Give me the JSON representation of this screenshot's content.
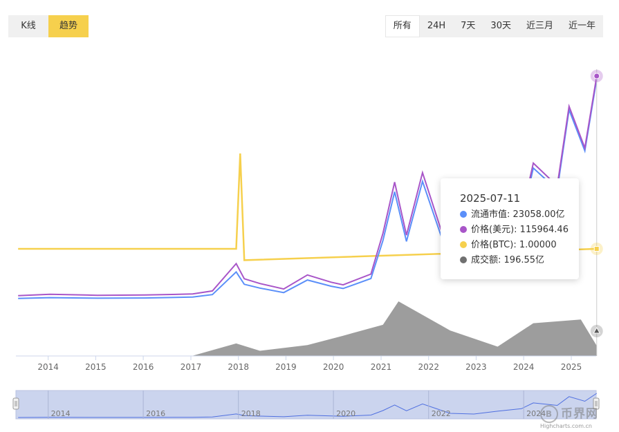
{
  "toolbar": {
    "modes": [
      {
        "label": "K线",
        "active": false
      },
      {
        "label": "趋势",
        "active": true
      }
    ],
    "ranges": [
      {
        "label": "所有",
        "active": true
      },
      {
        "label": "24H",
        "active": false
      },
      {
        "label": "7天",
        "active": false
      },
      {
        "label": "30天",
        "active": false
      },
      {
        "label": "近三月",
        "active": false
      },
      {
        "label": "近一年",
        "active": false
      }
    ]
  },
  "tooltip": {
    "date": "2025-07-11",
    "rows": [
      {
        "name": "流通市值",
        "value": "23058.00亿",
        "color": "#5b8ff9"
      },
      {
        "name": "价格(美元)",
        "value": "115964.46",
        "color": "#a855c8"
      },
      {
        "name": "价格(BTC)",
        "value": "1.00000",
        "color": "#f6d04d"
      },
      {
        "name": "成交额",
        "value": "196.55亿",
        "color": "#707070"
      }
    ]
  },
  "navigator": {
    "labels": [
      "2014",
      "2016",
      "2018",
      "2020",
      "2022",
      "2024"
    ]
  },
  "watermark": {
    "logo": "币界网",
    "credit": "Highcharts.com.cn"
  },
  "chart_data": {
    "type": "line",
    "x_range": [
      "2013-04-28",
      "2025-07-11"
    ],
    "x_ticks": [
      "2014",
      "2015",
      "2016",
      "2017",
      "2018",
      "2019",
      "2020",
      "2021",
      "2022",
      "2023",
      "2024",
      "2025"
    ],
    "colors": {
      "market_cap": "#5b8ff9",
      "price_usd": "#a855c8",
      "price_btc": "#f6d04d",
      "volume": "#8c8c8c"
    },
    "series": [
      {
        "name": "价格(美元)",
        "x": [
          "2013-05",
          "2014-01",
          "2015-01",
          "2016-01",
          "2017-01",
          "2017-06",
          "2017-12",
          "2018-02",
          "2018-06",
          "2018-12",
          "2019-06",
          "2019-12",
          "2020-03",
          "2020-10",
          "2021-01",
          "2021-04",
          "2021-07",
          "2021-11",
          "2022-06",
          "2022-12",
          "2023-06",
          "2023-12",
          "2024-03",
          "2024-09",
          "2024-12",
          "2025-04",
          "2025-07"
        ],
        "y": [
          120,
          800,
          300,
          430,
          1000,
          2600,
          17000,
          9000,
          6500,
          3600,
          11000,
          7200,
          5800,
          11500,
          33000,
          60000,
          32000,
          65000,
          20000,
          16500,
          30000,
          42000,
          70000,
          58000,
          100000,
          78000,
          115964
        ]
      },
      {
        "name": "流通市值",
        "x": [
          "2013-05",
          "2014-01",
          "2015-01",
          "2016-01",
          "2017-01",
          "2017-06",
          "2017-12",
          "2018-02",
          "2018-06",
          "2018-12",
          "2019-06",
          "2019-12",
          "2020-03",
          "2020-10",
          "2021-01",
          "2021-04",
          "2021-07",
          "2021-11",
          "2022-06",
          "2022-12",
          "2023-06",
          "2023-12",
          "2024-03",
          "2024-09",
          "2024-12",
          "2025-04",
          "2025-07"
        ],
        "y": [
          13,
          98,
          42,
          64,
          160,
          420,
          2800,
          1500,
          1100,
          630,
          1950,
          1300,
          1060,
          2100,
          6100,
          11200,
          6000,
          12300,
          3800,
          3170,
          5800,
          8200,
          13700,
          11400,
          19800,
          15500,
          23058
        ]
      },
      {
        "name": "价格(BTC)",
        "x": [
          "2013-05",
          "2017-12",
          "2018-01",
          "2018-02",
          "2025-07"
        ],
        "y": [
          1,
          1,
          5.2,
          0.5,
          1
        ]
      },
      {
        "name": "成交额",
        "x": [
          "2013-05",
          "2017-01",
          "2017-12",
          "2018-06",
          "2019-06",
          "2020-03",
          "2021-01",
          "2021-05",
          "2022-06",
          "2023-06",
          "2024-03",
          "2025-03",
          "2025-07"
        ],
        "y": [
          0,
          5,
          240,
          100,
          210,
          390,
          600,
          1050,
          490,
          180,
          630,
          700,
          196.55
        ]
      }
    ]
  }
}
